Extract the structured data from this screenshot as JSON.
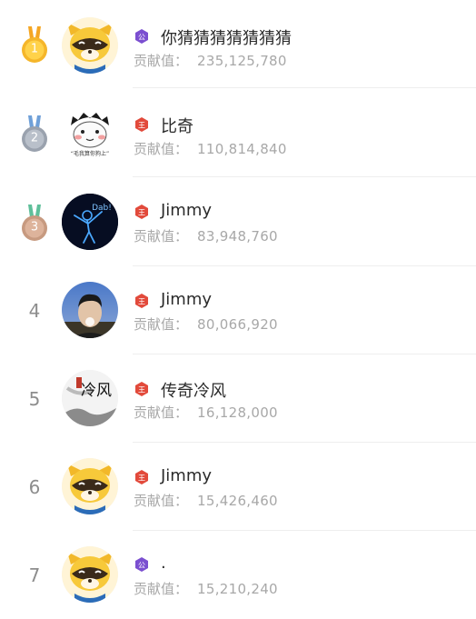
{
  "contrib_label": "贡献值：",
  "rows": [
    {
      "rank": "1",
      "name": "你猜猜猜猜猜猜猜",
      "badge": "公",
      "value": "235,125,780",
      "avatar": "raccoon-avatar",
      "medal": "gold"
    },
    {
      "rank": "2",
      "name": "比奇",
      "badge": "王",
      "value": "110,814,840",
      "avatar": "cartoon-face-avatar",
      "avatar_text": "“毛我算你狗上”",
      "medal": "silver"
    },
    {
      "rank": "3",
      "name": "Jimmy",
      "badge": "王",
      "value": "83,948,760",
      "avatar": "dab-neon-avatar",
      "avatar_text": "Dab!",
      "medal": "bronze"
    },
    {
      "rank": "4",
      "name": "Jimmy",
      "badge": "王",
      "value": "80,066,920",
      "avatar": "photo-avatar"
    },
    {
      "rank": "5",
      "name": "传奇冷风",
      "badge": "王",
      "value": "16,128,000",
      "avatar": "ink-calligraphy-avatar",
      "avatar_text": "冷风"
    },
    {
      "rank": "6",
      "name": "Jimmy",
      "badge": "王",
      "value": "15,426,460",
      "avatar": "raccoon-avatar"
    },
    {
      "rank": "7",
      "name": ".",
      "badge": "公",
      "value": "15,210,240",
      "avatar": "raccoon-avatar"
    }
  ],
  "colors": {
    "gold": "#f2b829",
    "silver": "#9aa2ae",
    "bronze": "#c79a80",
    "badge_purple": "#7b4fd0",
    "badge_red": "#e24a3b",
    "name": "#2b2b2b",
    "value": "#a8a8a8"
  }
}
